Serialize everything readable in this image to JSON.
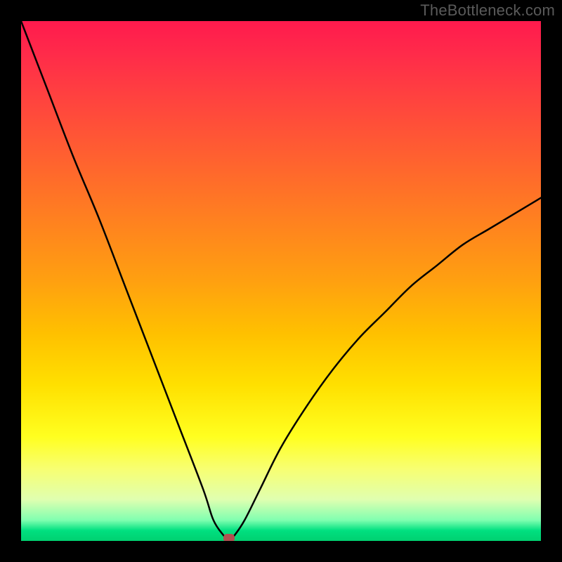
{
  "watermark": "TheBottleneck.com",
  "chart_data": {
    "type": "line",
    "title": "",
    "xlabel": "",
    "ylabel": "",
    "xlim": [
      0,
      100
    ],
    "ylim": [
      0,
      100
    ],
    "grid": false,
    "legend": false,
    "series": [
      {
        "name": "bottleneck-curve",
        "x": [
          0,
          5,
          10,
          15,
          20,
          25,
          30,
          35,
          37,
          39,
          40,
          41,
          43,
          46,
          50,
          55,
          60,
          65,
          70,
          75,
          80,
          85,
          90,
          95,
          100
        ],
        "values": [
          100,
          87,
          74,
          62,
          49,
          36,
          23,
          10,
          4,
          1,
          0,
          1,
          4,
          10,
          18,
          26,
          33,
          39,
          44,
          49,
          53,
          57,
          60,
          63,
          66
        ]
      }
    ],
    "annotations": [
      {
        "name": "marker-dot",
        "x": 40,
        "y": 0.5,
        "color": "#b05050"
      }
    ],
    "background_gradient": {
      "top": "#ff1a4d",
      "mid": "#ffe000",
      "bottom": "#00d070"
    }
  }
}
